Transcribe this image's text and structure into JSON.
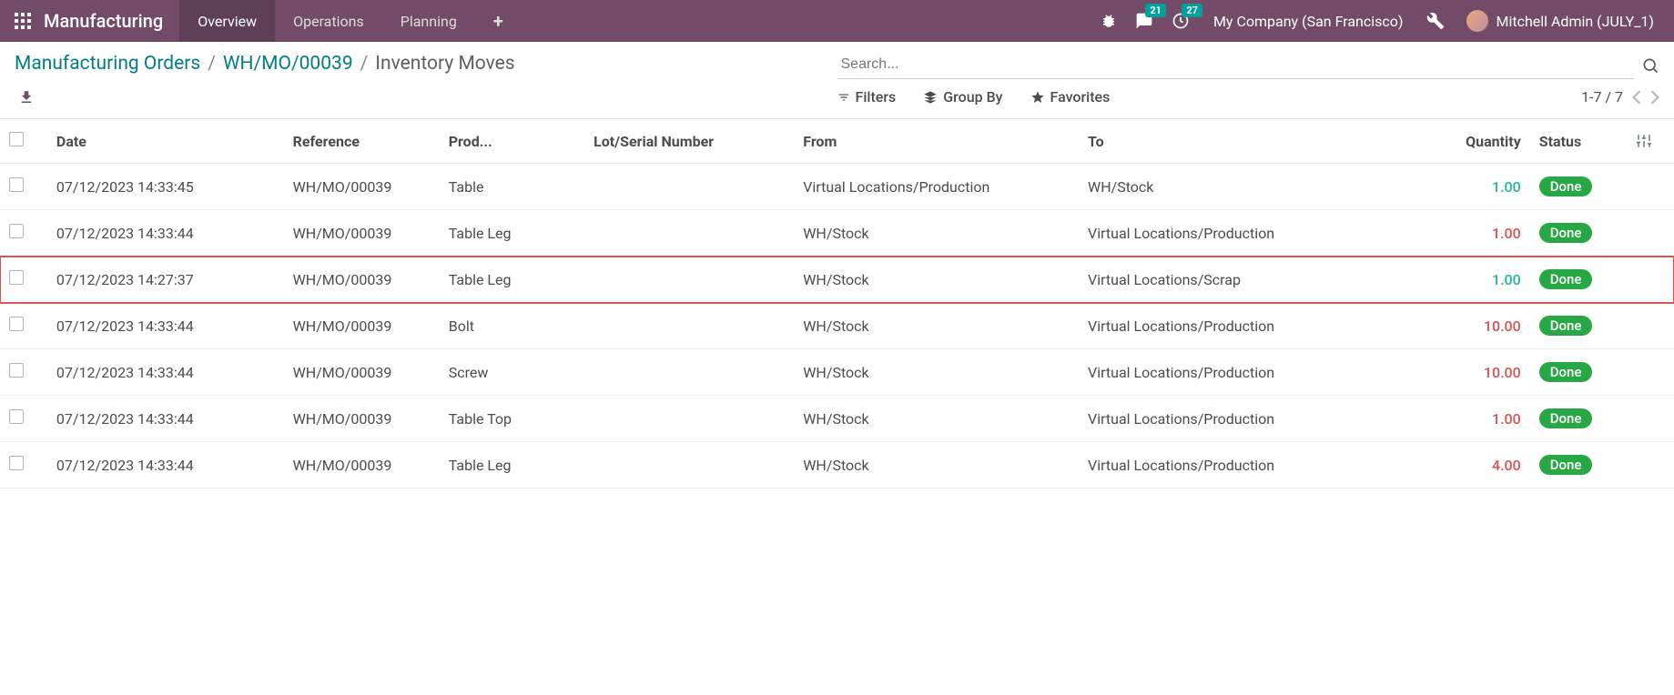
{
  "navbar": {
    "app_title": "Manufacturing",
    "menu": [
      {
        "label": "Overview",
        "active": true
      },
      {
        "label": "Operations",
        "active": false
      },
      {
        "label": "Planning",
        "active": false
      }
    ],
    "messages_badge": "21",
    "activities_badge": "27",
    "company": "My Company (San Francisco)",
    "user": "Mitchell Admin (JULY_1)"
  },
  "breadcrumb": {
    "root": "Manufacturing Orders",
    "parent": "WH/MO/00039",
    "current": "Inventory Moves"
  },
  "search": {
    "placeholder": "Search..."
  },
  "toolbar": {
    "filters": "Filters",
    "groupby": "Group By",
    "favorites": "Favorites",
    "pager": "1-7 / 7"
  },
  "columns": {
    "date": "Date",
    "reference": "Reference",
    "product": "Prod...",
    "lot": "Lot/Serial Number",
    "from": "From",
    "to": "To",
    "quantity": "Quantity",
    "status": "Status"
  },
  "rows": [
    {
      "date": "07/12/2023 14:33:45",
      "ref": "WH/MO/00039",
      "prod": "Table",
      "lot": "",
      "from": "Virtual Locations/Production",
      "to": "WH/Stock",
      "qty": "1.00",
      "qty_color": "green",
      "status": "Done",
      "highlight": false
    },
    {
      "date": "07/12/2023 14:33:44",
      "ref": "WH/MO/00039",
      "prod": "Table Leg",
      "lot": "",
      "from": "WH/Stock",
      "to": "Virtual Locations/Production",
      "qty": "1.00",
      "qty_color": "red",
      "status": "Done",
      "highlight": false
    },
    {
      "date": "07/12/2023 14:27:37",
      "ref": "WH/MO/00039",
      "prod": "Table Leg",
      "lot": "",
      "from": "WH/Stock",
      "to": "Virtual Locations/Scrap",
      "qty": "1.00",
      "qty_color": "green",
      "status": "Done",
      "highlight": true
    },
    {
      "date": "07/12/2023 14:33:44",
      "ref": "WH/MO/00039",
      "prod": "Bolt",
      "lot": "",
      "from": "WH/Stock",
      "to": "Virtual Locations/Production",
      "qty": "10.00",
      "qty_color": "red",
      "status": "Done",
      "highlight": false
    },
    {
      "date": "07/12/2023 14:33:44",
      "ref": "WH/MO/00039",
      "prod": "Screw",
      "lot": "",
      "from": "WH/Stock",
      "to": "Virtual Locations/Production",
      "qty": "10.00",
      "qty_color": "red",
      "status": "Done",
      "highlight": false
    },
    {
      "date": "07/12/2023 14:33:44",
      "ref": "WH/MO/00039",
      "prod": "Table Top",
      "lot": "",
      "from": "WH/Stock",
      "to": "Virtual Locations/Production",
      "qty": "1.00",
      "qty_color": "red",
      "status": "Done",
      "highlight": false
    },
    {
      "date": "07/12/2023 14:33:44",
      "ref": "WH/MO/00039",
      "prod": "Table Leg",
      "lot": "",
      "from": "WH/Stock",
      "to": "Virtual Locations/Production",
      "qty": "4.00",
      "qty_color": "red",
      "status": "Done",
      "highlight": false
    }
  ]
}
